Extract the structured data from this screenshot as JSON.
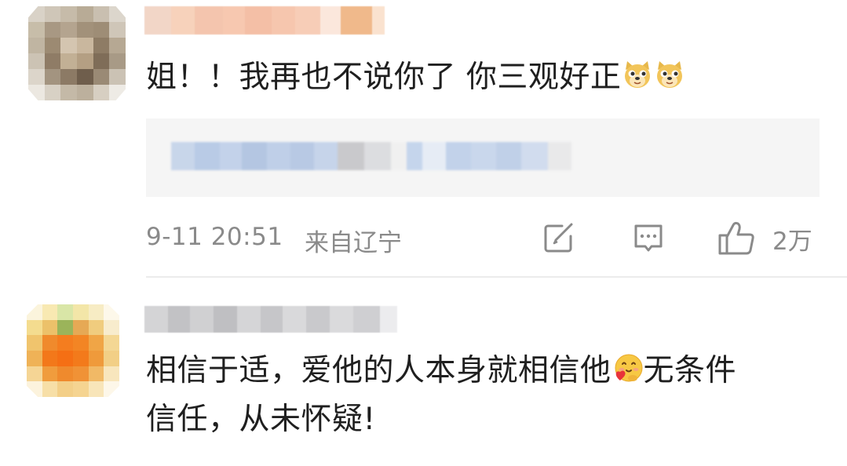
{
  "comments": [
    {
      "text": "姐！！我再也不说你了 你三观好正",
      "emojis": [
        "doge-emoji",
        "doge-emoji"
      ],
      "time": "9-11 20:51",
      "location": "来自辽宁",
      "likes": "2万",
      "actions": [
        "share-icon",
        "comment-icon",
        "like-icon"
      ]
    },
    {
      "text_line1": "相信于适，爱他的人本身就相信他",
      "emoji": "hug-heart-emoji",
      "text_after_emoji": "无条件",
      "text_line2": "信任，从未怀疑!"
    }
  ],
  "colors": {
    "meta_gray": "#8a8a8a",
    "reply_bg": "#f5f5f5",
    "text": "#1f1f1f",
    "divider": "#ececec"
  }
}
